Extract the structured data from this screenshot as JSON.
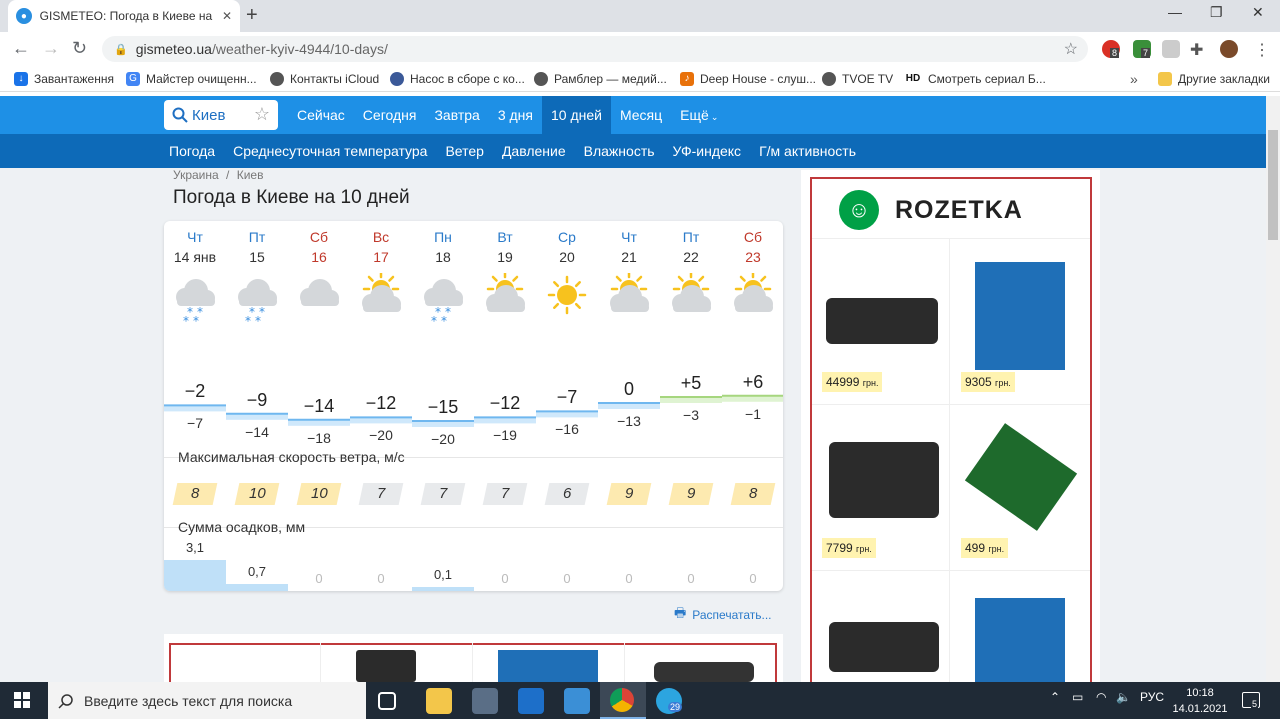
{
  "browser": {
    "tab_title": "GISMETEO: Погода в Киеве на 1",
    "tab_close": "✕",
    "new_tab": "+",
    "url_host": "gismeteo.ua",
    "url_path": "/weather-kyiv-4944/10-days/",
    "ext_badges": [
      "8",
      "7"
    ],
    "bookmarks": [
      {
        "label": "Завантаження",
        "icon": "download-icon",
        "color": "#1a73e8"
      },
      {
        "label": "Майстер очищенн...",
        "icon": "google-icon",
        "color": "#4285f4"
      },
      {
        "label": "Контакты iCloud",
        "icon": "globe-icon",
        "color": "#555555"
      },
      {
        "label": "Насос в сборе с ко...",
        "icon": "target-icon",
        "color": "#3b5998"
      },
      {
        "label": "Рамблер — медий...",
        "icon": "globe-icon",
        "color": "#555555"
      },
      {
        "label": "Deep House - слуш...",
        "icon": "music-icon",
        "color": "#e8710a"
      },
      {
        "label": "TVOE TV",
        "icon": "globe-icon",
        "color": "#555555"
      },
      {
        "label": "Смотреть сериал Б...",
        "icon": "hd-icon",
        "color": "#111111"
      }
    ],
    "bookmarks_more": "»",
    "other_bookmarks": "Другие закладки"
  },
  "site": {
    "search_value": "Киев",
    "top_nav": [
      "Сейчас",
      "Сегодня",
      "Завтра",
      "3 дня",
      "10 дней",
      "Месяц",
      "Ещё"
    ],
    "top_nav_active": "10 дней",
    "sub_nav": [
      "Погода",
      "Среднесуточная температура",
      "Ветер",
      "Давление",
      "Влажность",
      "УФ-индекс",
      "Г/м активность"
    ],
    "breadcrumb": [
      "Украина",
      "/",
      "Киев"
    ],
    "page_title": "Погода в Киеве на 10 дней"
  },
  "forecast": {
    "days": [
      {
        "dow": "Чт",
        "date": "14 янв",
        "weekend": false,
        "icon": "cloud-snow-icon",
        "tmax": "−2",
        "tmin": "−7",
        "wind": "8",
        "wind_gust": true,
        "precip": "3,1"
      },
      {
        "dow": "Пт",
        "date": "15",
        "weekend": false,
        "icon": "cloud-snow-icon",
        "tmax": "−9",
        "tmin": "−14",
        "wind": "10",
        "wind_gust": true,
        "precip": "0,7"
      },
      {
        "dow": "Сб",
        "date": "16",
        "weekend": true,
        "icon": "cloud-icon",
        "tmax": "−14",
        "tmin": "−18",
        "wind": "10",
        "wind_gust": true,
        "precip": "0"
      },
      {
        "dow": "Вс",
        "date": "17",
        "weekend": true,
        "icon": "partly-sunny-icon",
        "tmax": "−12",
        "tmin": "−20",
        "wind": "7",
        "wind_gust": false,
        "precip": "0"
      },
      {
        "dow": "Пн",
        "date": "18",
        "weekend": false,
        "icon": "cloud-snow-icon",
        "tmax": "−15",
        "tmin": "−20",
        "wind": "7",
        "wind_gust": false,
        "precip": "0,1"
      },
      {
        "dow": "Вт",
        "date": "19",
        "weekend": false,
        "icon": "partly-sunny-icon",
        "tmax": "−12",
        "tmin": "−19",
        "wind": "7",
        "wind_gust": false,
        "precip": "0"
      },
      {
        "dow": "Ср",
        "date": "20",
        "weekend": false,
        "icon": "sun-icon",
        "tmax": "−7",
        "tmin": "−16",
        "wind": "6",
        "wind_gust": false,
        "precip": "0"
      },
      {
        "dow": "Чт",
        "date": "21",
        "weekend": false,
        "icon": "partly-sunny-icon",
        "tmax": "0",
        "tmin": "−13",
        "wind": "9",
        "wind_gust": true,
        "precip": "0"
      },
      {
        "dow": "Пт",
        "date": "22",
        "weekend": false,
        "icon": "partly-sunny-icon",
        "tmax": "+5",
        "tmin": "−3",
        "wind": "9",
        "wind_gust": true,
        "precip": "0"
      },
      {
        "dow": "Сб",
        "date": "23",
        "weekend": true,
        "icon": "partly-sunny-icon",
        "tmax": "+6",
        "tmin": "−1",
        "wind": "8",
        "wind_gust": true,
        "precip": "0"
      }
    ],
    "wind_label": "Максимальная скорость ветра, м/с",
    "precip_label": "Сумма осадков, мм",
    "print_label": "Распечатать..."
  },
  "ad": {
    "brand": "ROZETKA",
    "prices": [
      {
        "amount": "44999",
        "unit": "грн."
      },
      {
        "amount": "9305",
        "unit": "грн."
      },
      {
        "amount": "7799",
        "unit": "грн."
      },
      {
        "amount": "499",
        "unit": "грн."
      }
    ]
  },
  "taskbar": {
    "search_placeholder": "Введите здесь текст для поиска",
    "lang": "РУС",
    "time": "10:18",
    "date": "14.01.2021",
    "telegram_badge": "29",
    "notif_badge": "5"
  }
}
